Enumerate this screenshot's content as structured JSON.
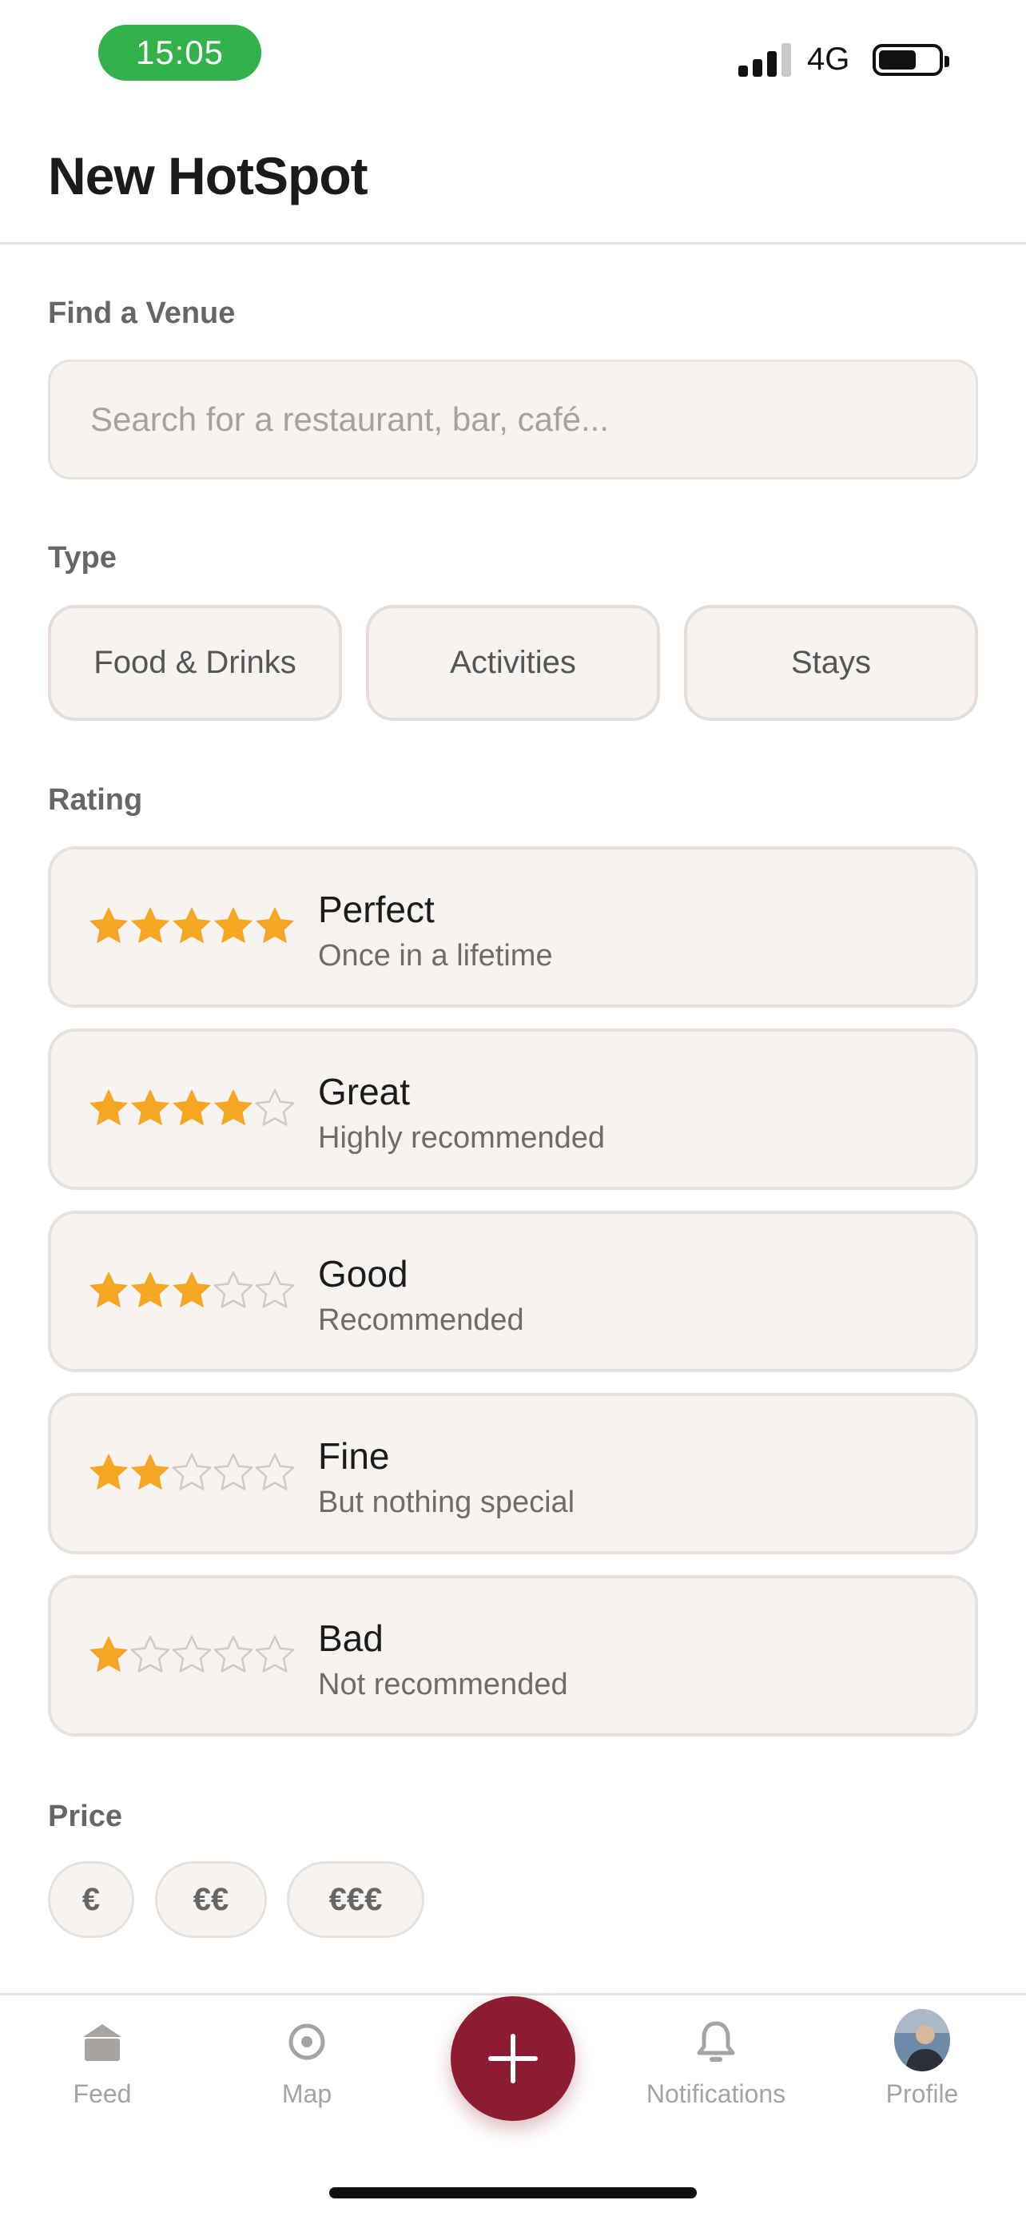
{
  "status_bar": {
    "time": "15:05",
    "network": "4G",
    "accent_color": "#33b14a"
  },
  "header": {
    "title": "New HotSpot"
  },
  "venue": {
    "label": "Find a Venue",
    "placeholder": "Search for a restaurant, bar, café..."
  },
  "type": {
    "label": "Type",
    "options": [
      "Food & Drinks",
      "Activities",
      "Stays"
    ]
  },
  "rating": {
    "label": "Rating",
    "star_color": "#f5a623",
    "options": [
      {
        "title": "Perfect",
        "subtitle": "Once in a lifetime",
        "stars": 5
      },
      {
        "title": "Great",
        "subtitle": "Highly recommended",
        "stars": 4
      },
      {
        "title": "Good",
        "subtitle": "Recommended",
        "stars": 3
      },
      {
        "title": "Fine",
        "subtitle": "But nothing special",
        "stars": 2
      },
      {
        "title": "Bad",
        "subtitle": "Not recommended",
        "stars": 1
      }
    ]
  },
  "price": {
    "label": "Price",
    "options": [
      "€",
      "€€",
      "€€€"
    ]
  },
  "tab_bar": {
    "items": [
      {
        "label": "Feed",
        "icon": "home-icon"
      },
      {
        "label": "Map",
        "icon": "map-pin-icon"
      },
      {
        "label": "Notifications",
        "icon": "bell-icon"
      },
      {
        "label": "Profile",
        "icon": "avatar"
      }
    ],
    "add_icon": "plus-icon",
    "add_color": "#8c1d30"
  }
}
